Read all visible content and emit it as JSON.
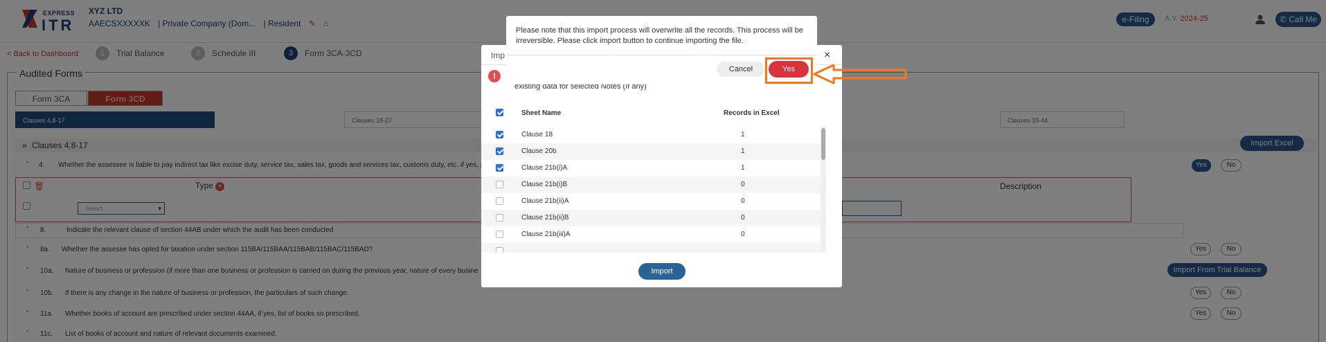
{
  "header": {
    "logo_top": "EXPRESS",
    "logo_main": "ITR",
    "client_name": "XYZ LTD",
    "pan": "AAECSXXXXXK",
    "entity_type": "| Private Company (Dom...",
    "residency": "| Resident",
    "efiling": "e-Filing",
    "ay_label": "A.Y.",
    "ay_value": "2024-25",
    "call_me": "Call Me"
  },
  "nav": {
    "back": "< Back to Dashboard",
    "steps": [
      {
        "num": "1",
        "label": "Trial Balance"
      },
      {
        "num": "2",
        "label": "Schedule III"
      },
      {
        "num": "3",
        "label": "Form 3CA-3CD"
      }
    ]
  },
  "forms": {
    "title": "Audited Forms",
    "tabs": [
      "Form 3CA",
      "Form 3CD"
    ],
    "clause_groups": [
      "Clauses 4,8-17",
      "Clauses 18-27",
      "Clauses 33-44"
    ],
    "section_header": "Clauses 4,8-17",
    "import_excel": "Import Excel",
    "type_label": "Type",
    "description_label": "Description",
    "select_placeholder": "Select",
    "import_from_tb": "Import From Trial Balance",
    "yes": "Yes",
    "no": "No",
    "rows": [
      {
        "n": "4.",
        "t": "Whether the assessee is liable to pay indirect tax like excise duty, service tax, sales tax, goods and services tax, customs duty, etc. if yes, p"
      },
      {
        "n": "8.",
        "t": "Indicate the relevant clause of section 44AB under which the audit has been conducted"
      },
      {
        "n": "8a.",
        "t": "Whether the assesse has opted for taxation under section 115BA/115BAA/115BAB/115BAC/115BAD?"
      },
      {
        "n": "10a.",
        "t": "Nature of business or profession (if more than one business or profession is carried on during the previous year, nature of every busine"
      },
      {
        "n": "10b.",
        "t": "If there is any change in the nature of business or profession, the particulars of such change."
      },
      {
        "n": "11a.",
        "t": "Whether books of account are prescribed under section 44AA, if yes, list of books so prescribed."
      },
      {
        "n": "11c.",
        "t": "List of books of account and nature of relevant documents examined."
      }
    ]
  },
  "import_modal": {
    "title": "Imp",
    "close": "×",
    "warning_text": "existing data for selected Notes (If any)",
    "col_sheet": "Sheet Name",
    "col_records": "Records in Excel",
    "rows": [
      {
        "sheet": "Clause 18",
        "records": "1",
        "checked": true
      },
      {
        "sheet": "Clause 20b",
        "records": "1",
        "checked": true
      },
      {
        "sheet": "Clause 21b(i)A",
        "records": "1",
        "checked": true
      },
      {
        "sheet": "Clause 21b(i)B",
        "records": "0",
        "checked": false
      },
      {
        "sheet": "Clause 21b(ii)A",
        "records": "0",
        "checked": false
      },
      {
        "sheet": "Clause 21b(ii)B",
        "records": "0",
        "checked": false
      },
      {
        "sheet": "Clause 21b(iii)A",
        "records": "0",
        "checked": false
      }
    ],
    "import_button": "Import"
  },
  "confirm_modal": {
    "message": "Please note that this import process will overwrite all the records. This process will be irreversible. Please click import button to continue importing the file.",
    "cancel": "Cancel",
    "yes": "Yes"
  },
  "colors": {
    "brand_blue": "#1c3c7a",
    "accent_red": "#c0392b",
    "yes_red": "#d9333f",
    "highlight_orange": "#f07820"
  }
}
